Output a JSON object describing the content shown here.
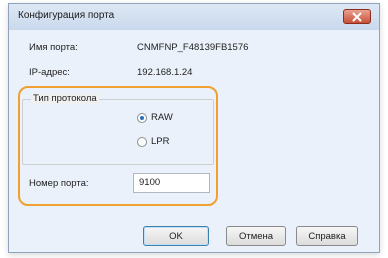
{
  "window": {
    "title": "Конфигурация порта"
  },
  "fields": {
    "port_name_label": "Имя порта:",
    "port_name_value": "CNMFNP_F48139FB1576",
    "ip_label": "IP-адрес:",
    "ip_value": "192.168.1.24"
  },
  "protocol_group": {
    "title": "Тип протокола",
    "options": [
      {
        "label": "RAW",
        "selected": true
      },
      {
        "label": "LPR",
        "selected": false
      }
    ],
    "port_number_label": "Номер порта:",
    "port_number_value": "9100"
  },
  "buttons": {
    "ok": "OK",
    "cancel": "Отмена",
    "help": "Справка"
  },
  "icons": {
    "close": "close-icon",
    "radio": "radio-button"
  },
  "colors": {
    "highlight": "#f0a030",
    "close_button": "#c74f37",
    "title_bar": "#c9d9ec"
  }
}
